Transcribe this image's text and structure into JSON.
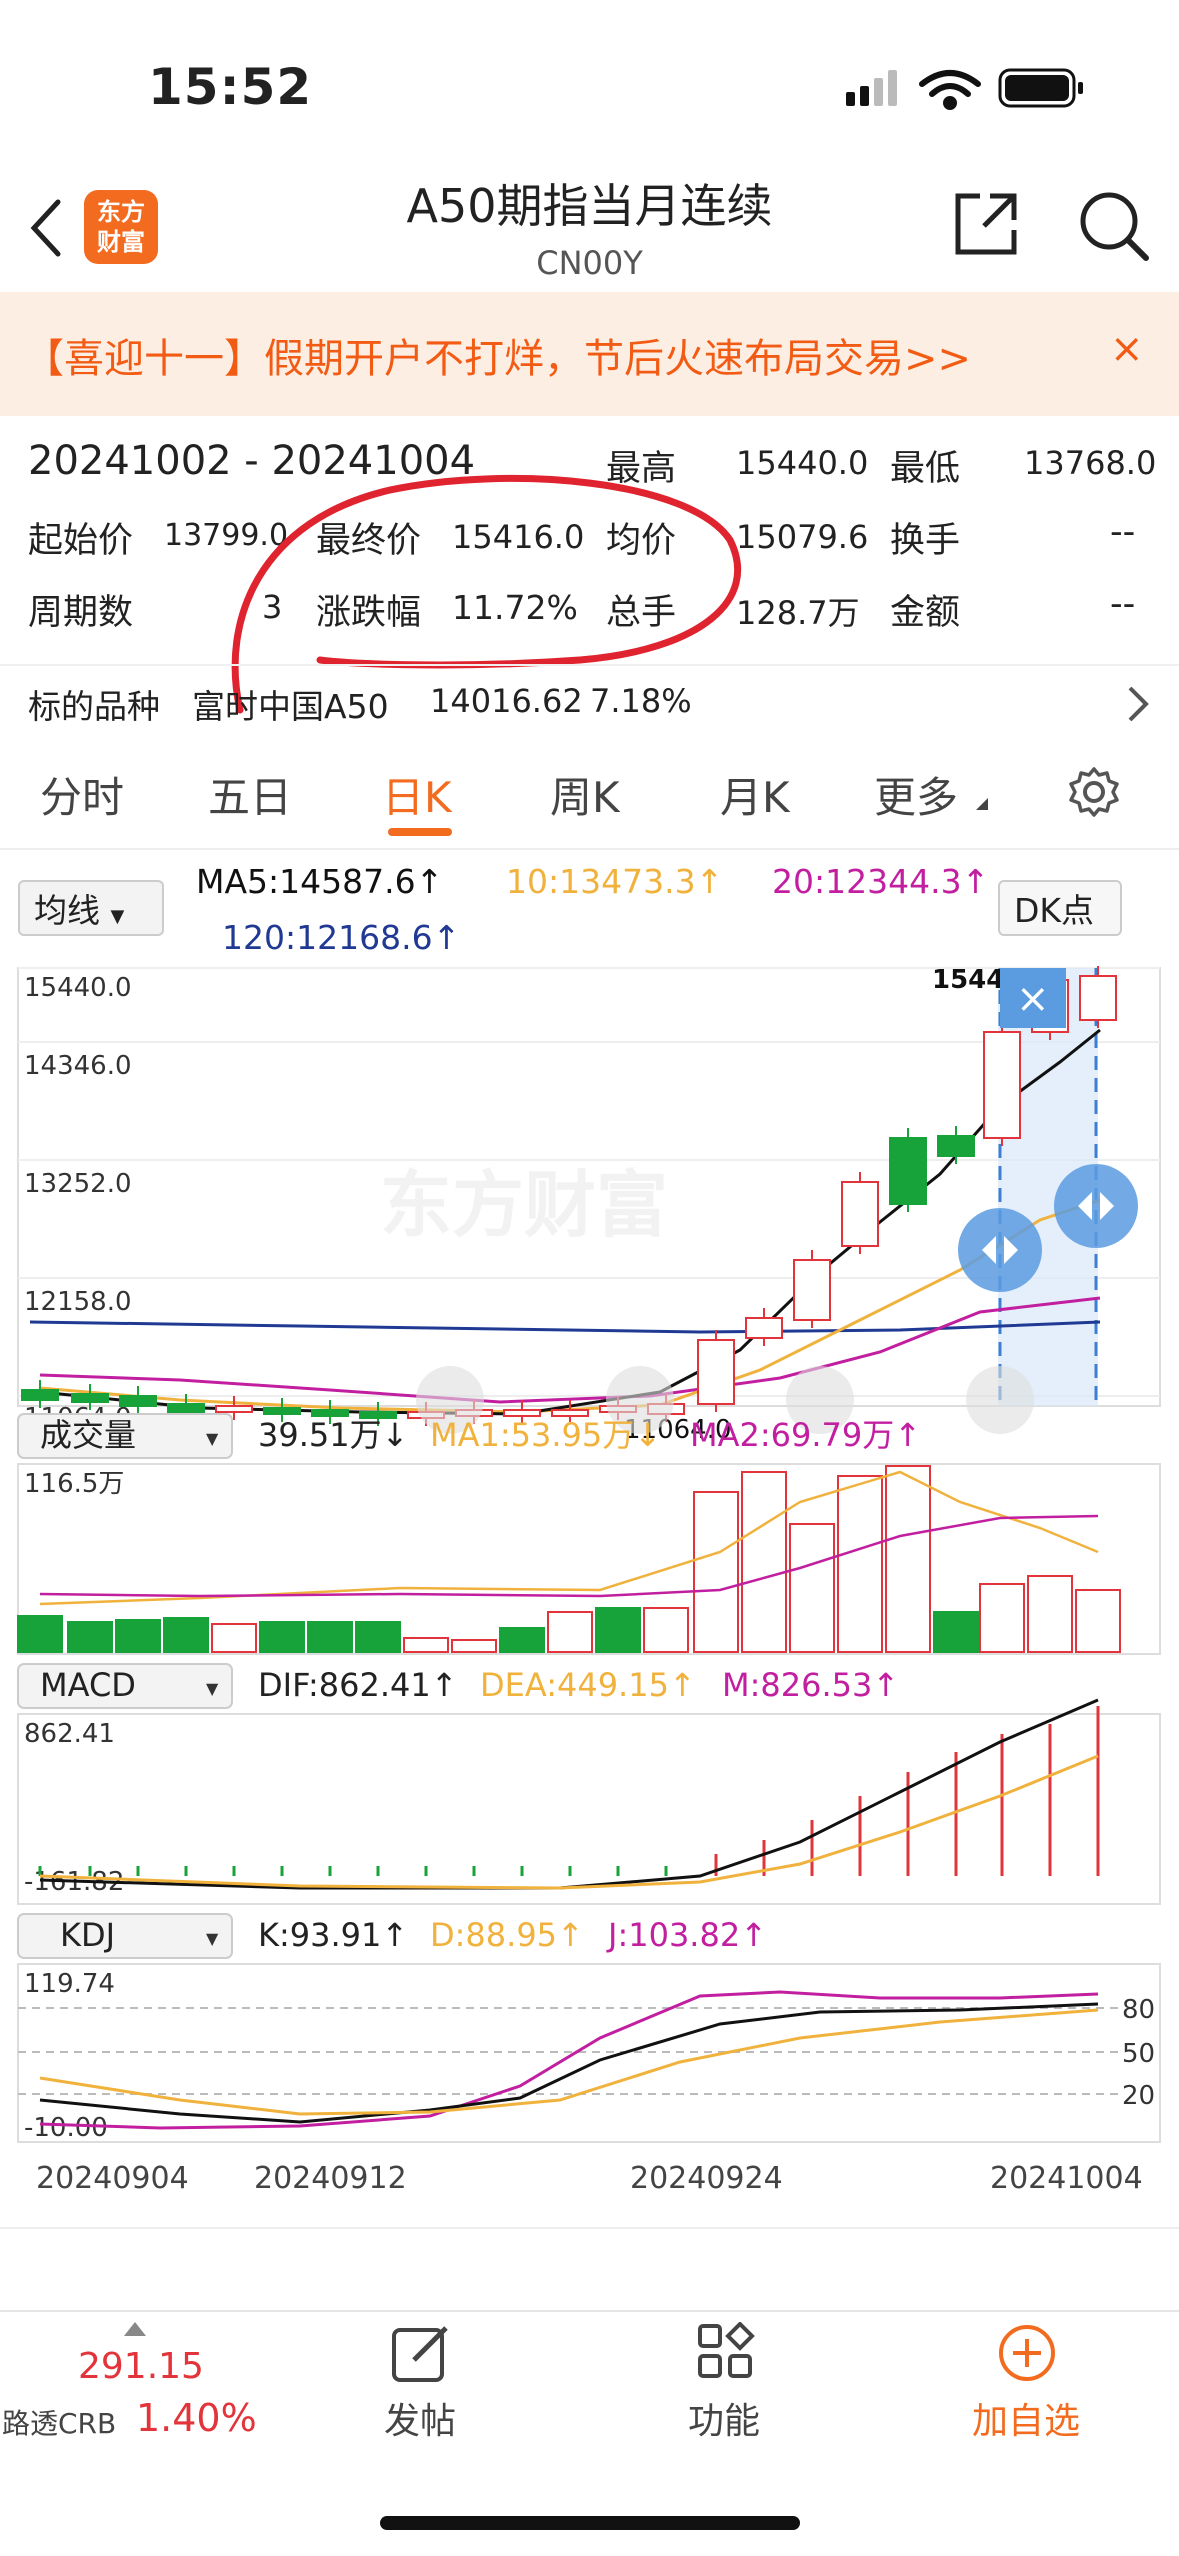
{
  "status": {
    "time": "15:52"
  },
  "header": {
    "back_icon": "chevron-left-icon",
    "logo": "东方\n财富",
    "title": "A50期指当月连续",
    "code": "CN00Y",
    "share_icon": "share-icon",
    "search_icon": "search-icon"
  },
  "banner": {
    "text": "【喜迎十一】假期开户不打烊，节后火速布局交易>>",
    "close": "×"
  },
  "summary": {
    "range": "20241002 - 20241004",
    "high_label": "最高",
    "high": "15440.0",
    "low_label": "最低",
    "low": "13768.0",
    "open_label": "起始价",
    "open": "13799.0",
    "close_label": "最终价",
    "close": "15416.0",
    "avg_label": "均价",
    "avg": "15079.6",
    "turnover_label": "换手",
    "turnover": "--",
    "periods_label": "周期数",
    "periods": "3",
    "chg_label": "涨跌幅",
    "chg": "11.72%",
    "vol_label": "总手",
    "vol": "128.7万",
    "amount_label": "金额",
    "amount": "--",
    "underlying_label": "标的品种",
    "underlying_name": "富时中国A50",
    "underlying_price": "14016.62",
    "underlying_chg": "7.18%"
  },
  "tabs": [
    "分时",
    "五日",
    "日K",
    "周K",
    "月K",
    "更多"
  ],
  "active_tab": "日K",
  "ma": {
    "select": "均线",
    "ma5": "MA5:14587.6↑",
    "ma10": "10:13473.3↑",
    "ma20": "20:12344.3↑",
    "ma120": "120:12168.6↑",
    "dk": "DK点"
  },
  "kline": {
    "y1": "15440.0",
    "y2": "14346.0",
    "y3": "13252.0",
    "y4": "12158.0",
    "y5": "11064.0",
    "high_tag": "15440.0",
    "low_tag": "11064.0",
    "watermark": "东方财富"
  },
  "volume": {
    "select": "成交量",
    "val": "39.51万↓",
    "ma1": "MA1:53.95万↓",
    "ma2": "MA2:69.79万↑",
    "ymax": "116.5万"
  },
  "macd": {
    "select": "MACD",
    "dif": "DIF:862.41↑",
    "dea": "DEA:449.15↑",
    "m": "M:826.53↑",
    "ymax": "862.41",
    "ymin": "-161.82"
  },
  "kdj": {
    "select": "KDJ",
    "k": "K:93.91↑",
    "d": "D:88.95↑",
    "j": "J:103.82↑",
    "ymax": "119.74",
    "ymin": "-10.00",
    "l80": "80",
    "l50": "50",
    "l20": "20"
  },
  "dates": [
    "20240904",
    "20240912",
    "20240924",
    "20241004"
  ],
  "colors": {
    "up": "#e2343a",
    "down": "#18a33a",
    "ma5": "#111111",
    "ma10": "#f0b23c",
    "ma20": "#c21fa0",
    "ma120": "#203a94",
    "accent": "#f26b1f"
  },
  "bottom": {
    "price": "291.15",
    "name": "路透CRB",
    "pct": "1.40%",
    "post": "发帖",
    "func": "功能",
    "add": "加自选"
  }
}
